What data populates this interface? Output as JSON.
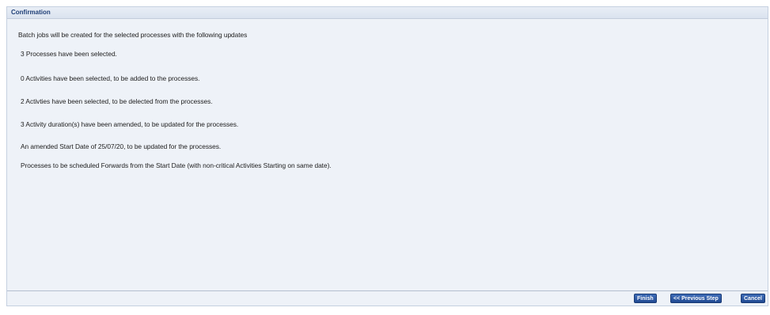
{
  "panel": {
    "title": "Confirmation"
  },
  "messages": {
    "intro": "Batch jobs will be created for the selected processes with the following updates",
    "processes_selected": "3 Processes have been selected.",
    "activities_added": "0 Activities have been selected, to be added to the processes.",
    "activities_deleted": "2 Activties have been selected, to be delected from the processes.",
    "durations_amended": "3 Activity duration(s) have been amended, to be updated for the processes.",
    "start_date": "An amended Start Date of 25/07/20, to be updated for the processes.",
    "scheduling": "Processes to be scheduled Forwards from the Start Date (with non-critical Activities Starting on same date)."
  },
  "buttons": {
    "finish": "Finish",
    "previous": "<< Previous Step",
    "cancel": "Cancel"
  },
  "colors": {
    "header_text": "#1f3f77",
    "button_bg": "#2b559e",
    "panel_bg": "#eef2f8"
  }
}
